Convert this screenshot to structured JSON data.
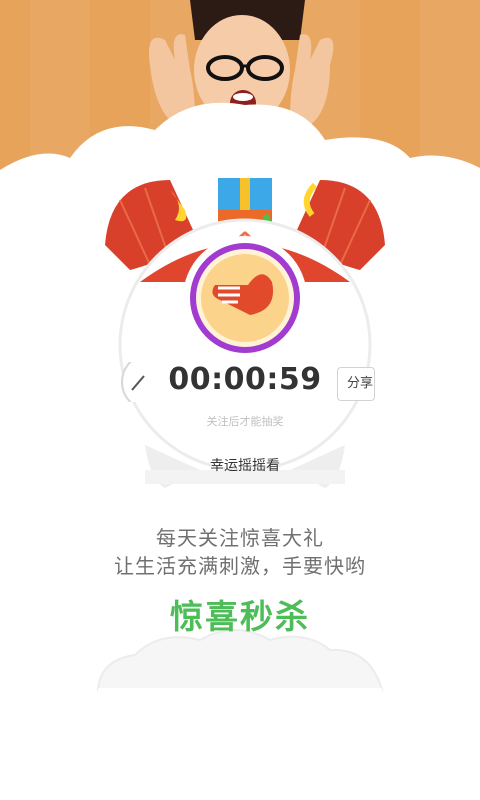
{
  "countdown": {
    "time": "00:00:59",
    "hint": "关注后才能抽奖"
  },
  "buttons": {
    "share_label": "分享",
    "shake_label": "幸运摇摇看"
  },
  "promo": {
    "line1": "每天关注惊喜大礼",
    "line2": "让生活充满刺激，手要快哟",
    "headline": "惊喜秒杀"
  },
  "colors": {
    "hero_bg": "#e7a35a",
    "bell_red": "#d9402c",
    "headline_green": "#4cbd57",
    "ring_purple": "#a23bd0",
    "ring_orange": "#f0a23a"
  }
}
